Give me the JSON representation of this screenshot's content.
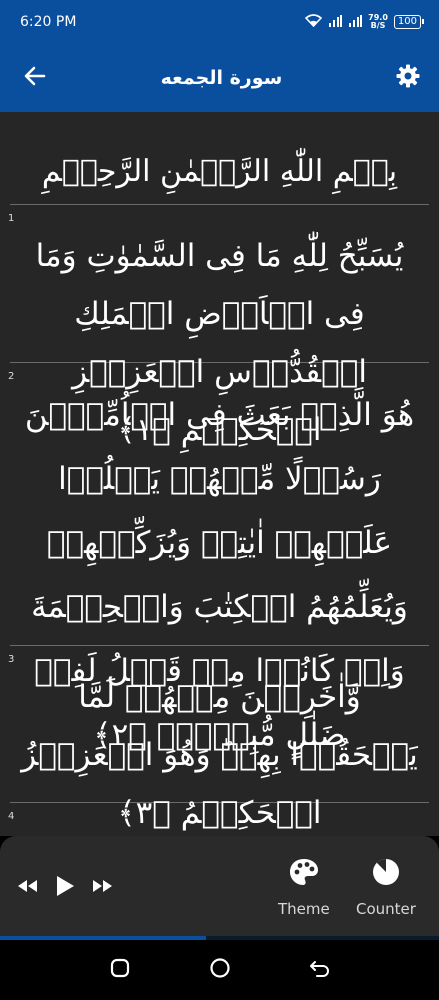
{
  "status_bar": {
    "time": "6:20 PM",
    "speed_value": "79.0",
    "speed_unit": "B/S",
    "battery": "100"
  },
  "app_bar": {
    "title": "سورة الجمعه",
    "back_icon": "arrow-left-icon",
    "settings_icon": "gear-icon"
  },
  "content": {
    "bismillah": "بِسۡمِ اللّٰهِ الرَّحۡمٰنِ الرَّحِيۡمِ",
    "ayahs": [
      {
        "number": "1",
        "text": "يُسَبِّحُ لِلّٰهِ مَا فِى السَّمٰوٰتِ وَمَا فِى الۡاَرۡضِ الۡمَلِكِ الۡقُدُّوۡسِ الۡعَزِيۡزِ الۡحَكِيۡمِ ﴿۱﴾"
      },
      {
        "number": "2",
        "text": "هُوَ الَّذِىۡ بَعَثَ فِى الۡاُمِّيّٖنَ رَسُوۡلًا مِّنۡهُمۡ يَتۡلُوۡا عَلَيۡهِمۡ اٰيٰتِهٖ وَيُزَكِّيۡهِمۡ وَيُعَلِّمُهُمُ الۡكِتٰبَ وَالۡحِكۡمَةَ وَاِنۡ كَانُوۡا مِنۡ قَبۡلُ لَفِىۡ ضَلٰلٍ مُّبِيۡنٍۙ ﴿۲﴾"
      },
      {
        "number": "3",
        "text": "وَّاٰخَرِيۡنَ مِنۡهُمۡ لَمَّا يَلۡحَقُوۡا بِهِمۡ‌ؕ وَهُوَ الۡعَزِيۡزُ الۡحَكِيۡمُ ﴿۳﴾"
      },
      {
        "number": "4"
      }
    ]
  },
  "player": {
    "rewind_icon": "rewind-icon",
    "play_icon": "play-icon",
    "forward_icon": "fast-forward-icon",
    "theme_label": "Theme",
    "theme_icon": "palette-icon",
    "counter_label": "Counter",
    "counter_icon": "pie-timer-icon",
    "progress": 0.47
  },
  "nav_bar": {
    "recents_icon": "recents-icon",
    "home_icon": "home-icon",
    "back_icon": "nav-back-icon"
  },
  "colors": {
    "primary": "#0a4e9e",
    "background": "#262626",
    "panel": "#2a2a2a"
  }
}
